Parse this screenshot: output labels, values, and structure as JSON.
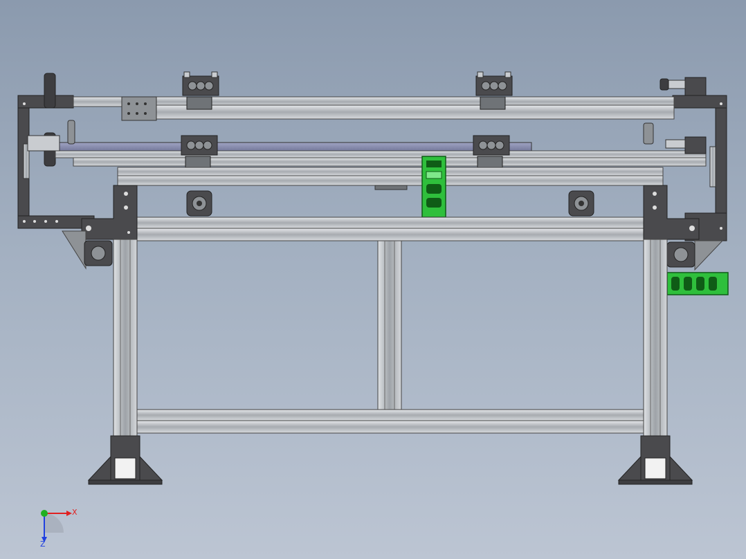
{
  "viewport": {
    "background_top": "#8b9aae",
    "background_bottom": "#bcc5d3"
  },
  "colors": {
    "frame_dark": "#4a4a4d",
    "frame_mid": "#8e9296",
    "frame_light": "#c9ccd0",
    "slide_blue": "#7f83a6",
    "cable_chain": "#2fbf3c",
    "cable_chain_dark": "#0f5c16",
    "foot_white": "#f2f2f2"
  },
  "icons": {
    "triad": "axis-triad-icon",
    "bracket": "mounting-bracket-icon",
    "chain": "cable-chain-icon"
  },
  "triad": {
    "x_label": "X",
    "z_label": "Z",
    "x_color": "#e02020",
    "y_color": "#20b020",
    "z_color": "#2040e0"
  }
}
